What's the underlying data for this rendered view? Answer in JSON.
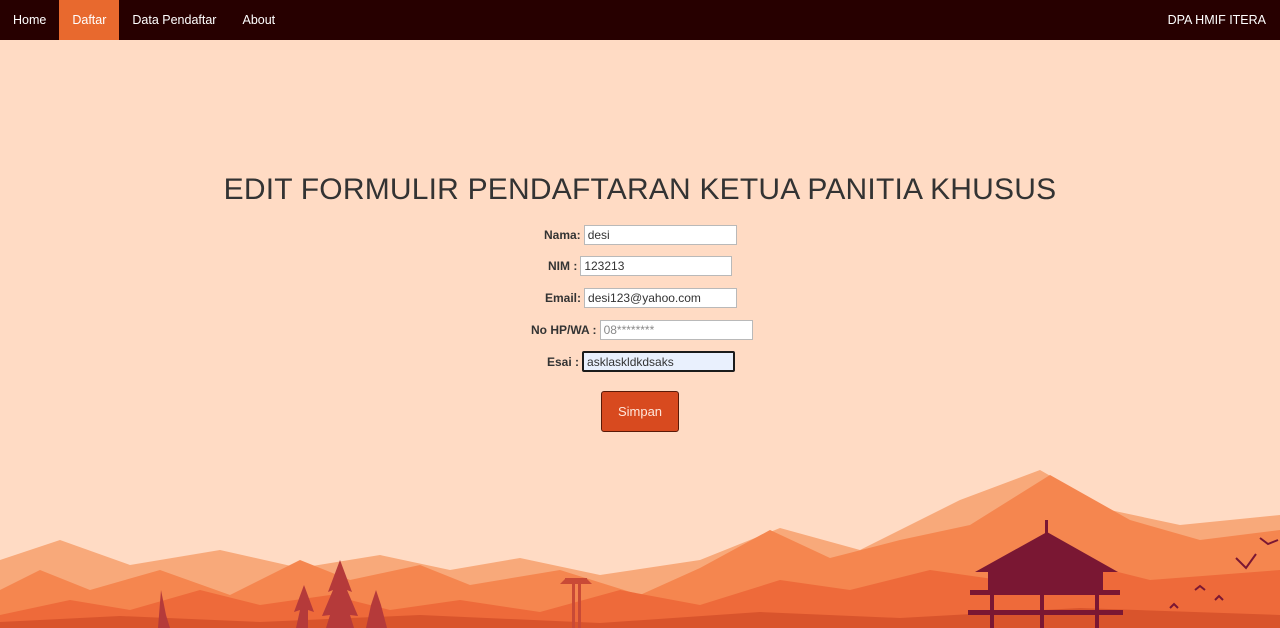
{
  "nav": {
    "items": [
      {
        "label": "Home",
        "active": false
      },
      {
        "label": "Daftar",
        "active": true
      },
      {
        "label": "Data Pendaftar",
        "active": false
      },
      {
        "label": "About",
        "active": false
      }
    ],
    "brand": "DPA HMIF ITERA"
  },
  "page": {
    "title": "EDIT FORMULIR PENDAFTARAN KETUA PANITIA KHUSUS"
  },
  "form": {
    "nama": {
      "label": "Nama:",
      "value": "desi"
    },
    "nim": {
      "label": "NIM :",
      "value": "123213"
    },
    "email": {
      "label": "Email:",
      "value": "desi123@yahoo.com"
    },
    "nohp": {
      "label": "No HP/WA :",
      "value": "",
      "placeholder": "08********"
    },
    "esai": {
      "label": "Esai :",
      "value": "asklaskldkdsaks"
    },
    "submit_label": "Simpan"
  },
  "colors": {
    "navbar": "#270000",
    "nav_active": "#e8692e",
    "background": "#ffdbc4",
    "button": "#d84a1f"
  }
}
